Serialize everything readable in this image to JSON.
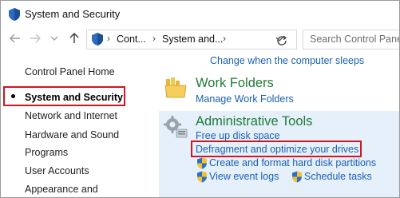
{
  "window": {
    "title": "System and Security"
  },
  "nav": {
    "breadcrumbs": [
      "Cont...",
      "System and...",
      ""
    ],
    "search_placeholder": "Search Control Pane"
  },
  "sidebar": {
    "items": [
      {
        "label": "Control Panel Home"
      },
      {
        "label": "System and Security",
        "active": true
      },
      {
        "label": "Network and Internet"
      },
      {
        "label": "Hardware and Sound"
      },
      {
        "label": "Programs"
      },
      {
        "label": "User Accounts"
      },
      {
        "label": "Appearance and"
      }
    ]
  },
  "main": {
    "sleep_link": "Change when the computer sleeps",
    "work_folders": {
      "title": "Work Folders",
      "tasks": [
        "Manage Work Folders"
      ]
    },
    "admin_tools": {
      "title": "Administrative Tools",
      "tasks": [
        "Free up disk space",
        "Defragment and optimize your drives",
        "Create and format hard disk partitions",
        "View event logs",
        "Schedule tasks"
      ]
    }
  },
  "colors": {
    "link": "#1a5fb4",
    "category": "#1f7a37",
    "highlight": "#d0161f"
  }
}
